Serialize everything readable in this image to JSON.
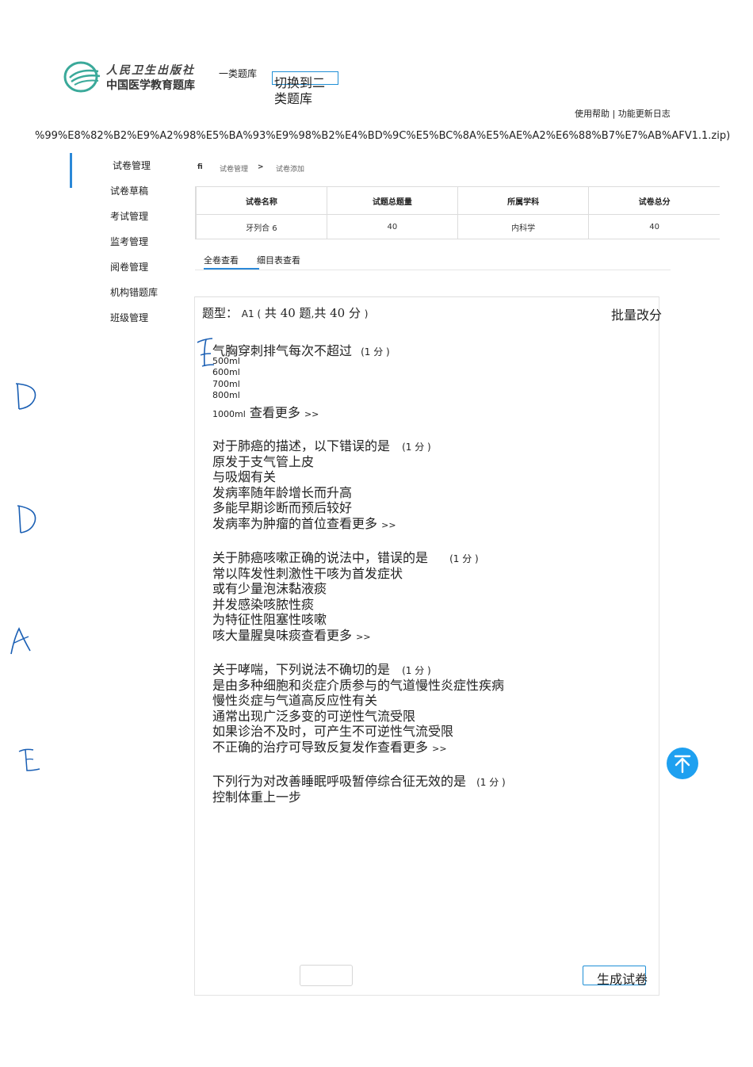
{
  "header": {
    "logo_line1": "人民卫生出版社",
    "logo_line2": "中国医学教育题库",
    "bank_label": "一类题库",
    "switch_line1": "切换到二",
    "switch_line2": "类题库",
    "help_links": "使用帮助 | 功能更新日志",
    "url_fragment": "%99%E8%82%B2%E9%A2%98%E5%BA%93%E9%98%B2%E4%BD%9C%E5%BC%8A%E5%AE%A2%E6%88%B7%E7%AB%AFV1.1.zip)"
  },
  "sidebar": {
    "items": [
      {
        "label": "试卷管理"
      },
      {
        "label": "试卷草稿"
      },
      {
        "label": "考试管理"
      },
      {
        "label": "监考管理"
      },
      {
        "label": "阅卷管理"
      },
      {
        "label": "机构错题库"
      },
      {
        "label": "班级管理"
      }
    ]
  },
  "breadcrumb": {
    "home": "fi",
    "level1": "试卷管理",
    "sep": ">",
    "level2": "试卷添加"
  },
  "paper_table": {
    "headers": [
      "试卷名称",
      "试题总题量",
      "所属学科",
      "试卷总分"
    ],
    "row": [
      "牙列合 6",
      "40",
      "内科学",
      "40"
    ]
  },
  "tabs": [
    {
      "label": "全卷查看",
      "active": true
    },
    {
      "label": "细目表查看",
      "active": false
    }
  ],
  "question_section": {
    "type_label": "题型：",
    "type_code": "A1 (",
    "count_text": "共 40 题",
    "comma": ",",
    "score_text": "共 40 分",
    "close": ")",
    "batch_button": "批量改分"
  },
  "questions": [
    {
      "stem": "气胸穿刺排气每次不超过",
      "score": "(1 分 )",
      "options": [
        "500ml",
        "600ml",
        "700ml",
        "800ml"
      ],
      "last_option": "1000ml",
      "more": "查看更多",
      "more_arrow": ">>"
    },
    {
      "stem": "对于肺癌的描述，以下错误的是",
      "score": "(1 分 )",
      "options": [
        "原发于支气管上皮",
        "与吸烟有关",
        "发病率随年龄增长而升高",
        "多能早期诊断而预后较好"
      ],
      "last_option": "发病率为肿瘤的首位",
      "more": "查看更多",
      "more_arrow": ">>"
    },
    {
      "stem": "关于肺癌咳嗽正确的说法中，错误的是",
      "score": "(1 分 )",
      "options": [
        "常以阵发性刺激性干咳为首发症状",
        "或有少量泡沫黏液痰",
        "并发感染咳脓性痰",
        "为特征性阻塞性咳嗽"
      ],
      "last_option": "咳大量腥臭味痰",
      "more": "查看更多",
      "more_arrow": ">>"
    },
    {
      "stem": "关于哮喘，下列说法不确切的是",
      "score": "(1 分 )",
      "options": [
        "是由多种细胞和炎症介质参与的气道慢性炎症性疾病",
        "慢性炎症与气道高反应性有关",
        "通常出现广泛多变的可逆性气流受限",
        "如果诊治不及时，可产生不可逆性气流受限"
      ],
      "last_option": "不正确的治疗可导致反复发作",
      "more": "查看更多",
      "more_arrow": ">>"
    },
    {
      "stem": "下列行为对改善睡眠呼吸暂停综合征无效的是",
      "score": "(1 分 )",
      "options": [
        "控制体重上一步"
      ]
    }
  ],
  "footer": {
    "generate_button": "生成试卷"
  },
  "colors": {
    "accent": "#2b88d8",
    "top_button": "#1ea0f0",
    "handwriting": "#1a5fb4"
  },
  "icons": {
    "back_to_top": "arrow-up-bar-icon",
    "logo": "pmph-logo-icon"
  }
}
